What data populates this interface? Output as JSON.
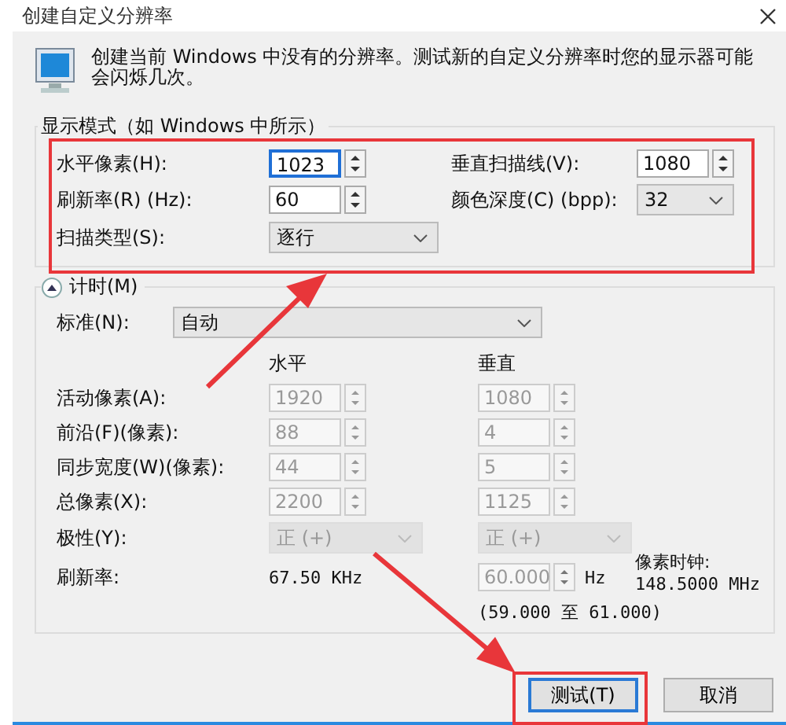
{
  "window": {
    "title": "创建自定义分辨率"
  },
  "intro": "创建当前 Windows 中没有的分辨率。测试新的自定义分辨率时您的显示器可能会闪烁几次。",
  "display_mode": {
    "title": "显示模式（如 Windows 中所示）",
    "fields": [
      {
        "label": "水平像素(H):",
        "value": "1023",
        "kind": "spin",
        "focused": true
      },
      {
        "label": "垂直扫描线(V):",
        "value": "1080",
        "kind": "spin",
        "focused": false
      },
      {
        "label": "刷新率(R) (Hz):",
        "value": "60",
        "kind": "spin",
        "focused": false
      },
      {
        "label": "颜色深度(C) (bpp):",
        "value": "32",
        "kind": "select",
        "focused": false
      },
      {
        "label": "扫描类型(S):",
        "value": "逐行",
        "kind": "select",
        "focused": false
      }
    ]
  },
  "timing": {
    "label": "计时(M)",
    "expanded": true,
    "standard": {
      "label": "标准(N):",
      "value": "自动"
    },
    "headers": [
      "水平",
      "垂直"
    ],
    "rows": [
      {
        "label": "活动像素(A):",
        "kind": "spin",
        "horizontal": "1920",
        "vertical": "1080",
        "disabled": true
      },
      {
        "label": "前沿(F)(像素):",
        "kind": "spin",
        "horizontal": "88",
        "vertical": "4",
        "disabled": true
      },
      {
        "label": "同步宽度(W)(像素):",
        "kind": "spin",
        "horizontal": "44",
        "vertical": "5",
        "disabled": true
      },
      {
        "label": "总像素(X):",
        "kind": "spin",
        "horizontal": "2200",
        "vertical": "1125",
        "disabled": true
      },
      {
        "label": "极性(Y):",
        "kind": "select",
        "horizontal": "正 (+)",
        "vertical": "正 (+)",
        "disabled": true
      }
    ],
    "refresh": {
      "label": "刷新率:",
      "horizontal": "67.50 KHz",
      "vertical": "60.000",
      "unit": "Hz",
      "range": "(59.000 至 61.000)"
    },
    "pixel_clock": {
      "label": "像素时钟:",
      "value": "148.5000 MHz"
    }
  },
  "buttons": [
    {
      "label": "测试(T)",
      "default": true
    },
    {
      "label": "取消",
      "default": false
    }
  ]
}
